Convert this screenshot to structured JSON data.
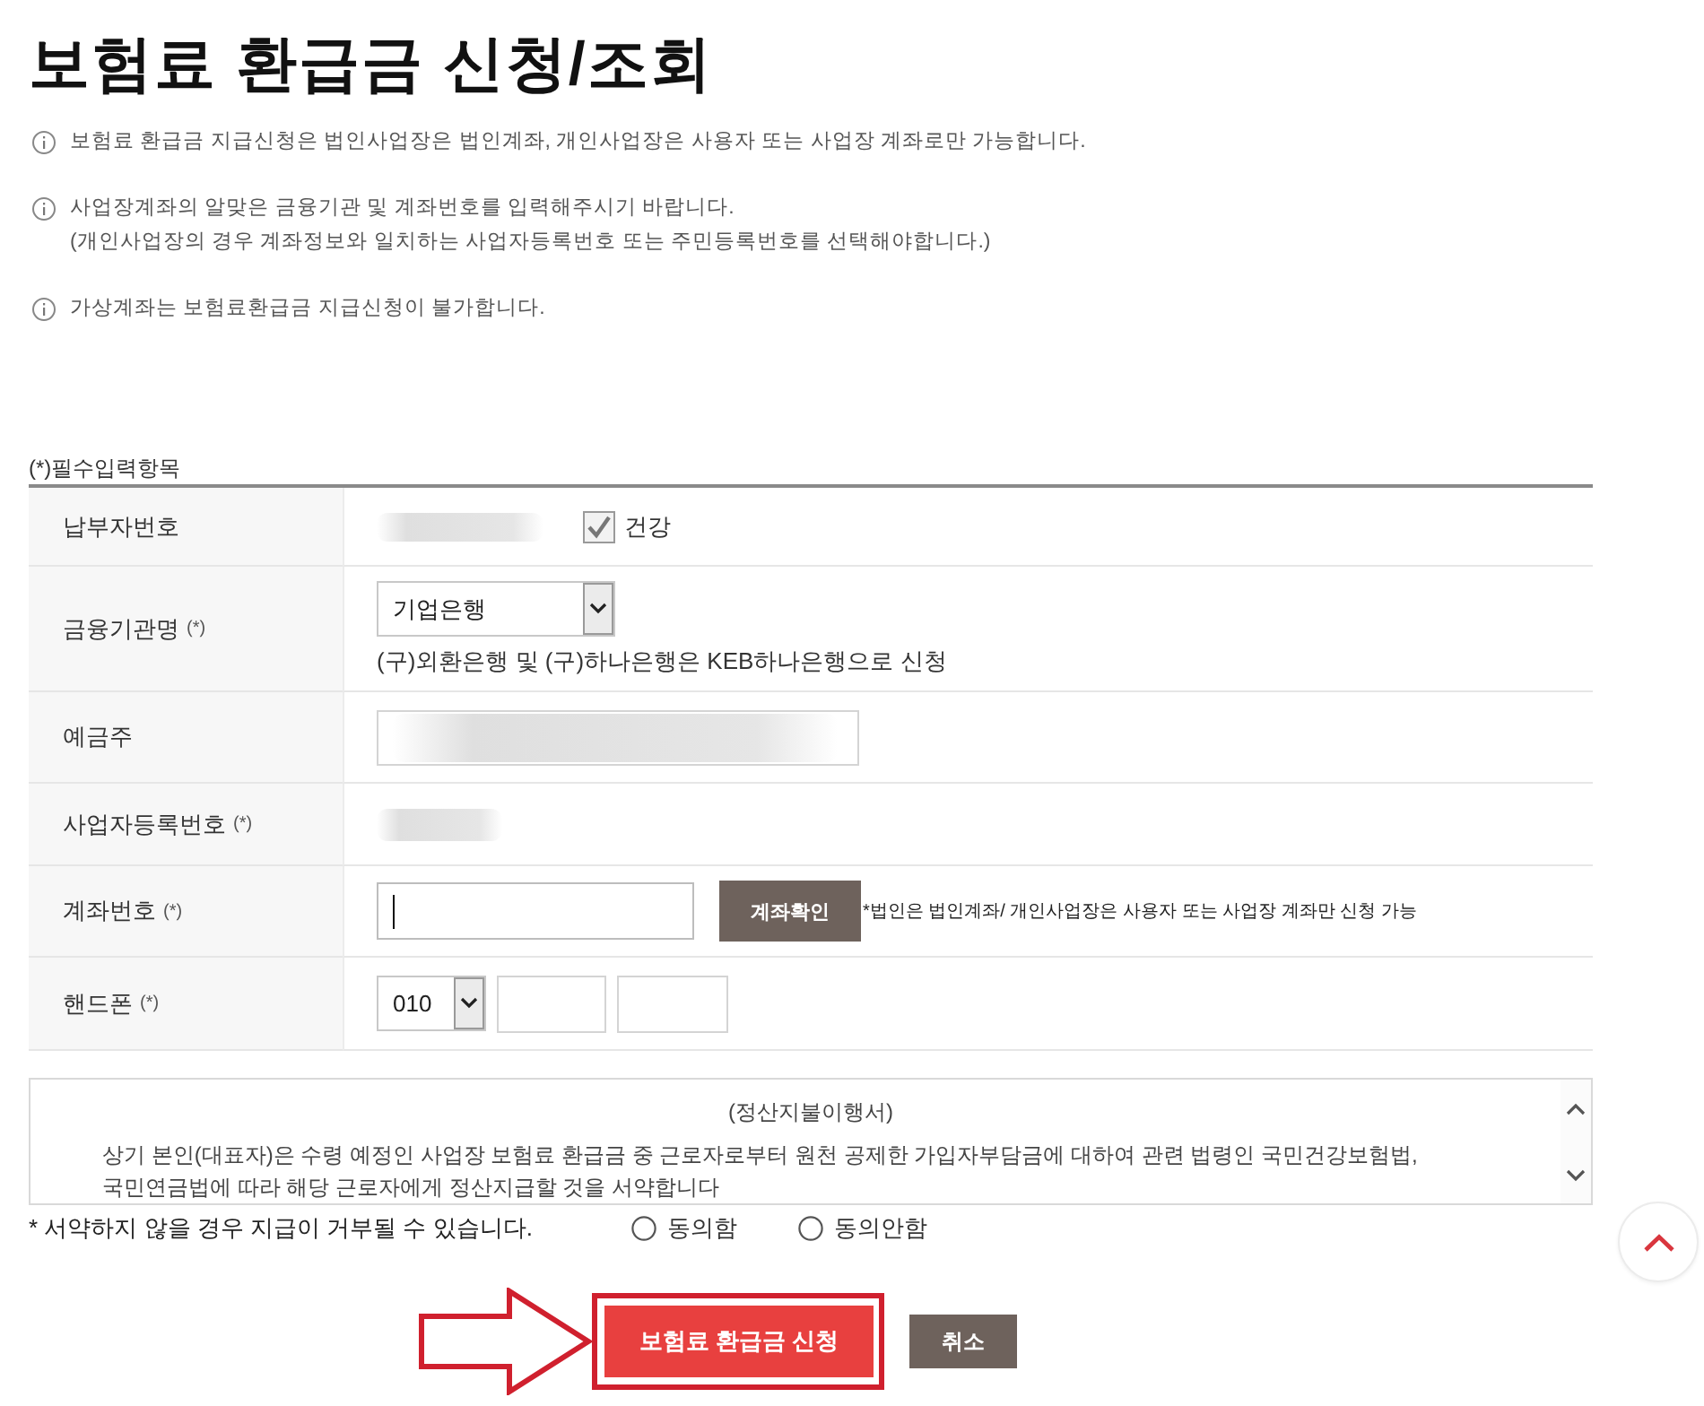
{
  "title": "보험료 환급금 신청/조회",
  "notices": [
    {
      "lines": [
        "보험료 환급금 지급신청은 법인사업장은 법인계좌, 개인사업장은 사용자 또는 사업장 계좌로만 가능합니다."
      ]
    },
    {
      "lines": [
        "사업장계좌의 알맞은 금융기관 및 계좌번호를 입력해주시기 바랍니다.",
        "(개인사업장의 경우 계좌정보와 일치하는 사업자등록번호 또는 주민등록번호를 선택해야합니다.)"
      ]
    },
    {
      "lines": [
        "가상계좌는 보험료환급금 지급신청이 불가합니다."
      ]
    }
  ],
  "required_note": "(*)필수입력항목",
  "form": {
    "rows": [
      {
        "kind": "payer",
        "label": "납부자번호",
        "checkbox": {
          "label": "건강",
          "checked": true
        }
      },
      {
        "kind": "bank",
        "label": "금융기관명",
        "required_mark": "(*)",
        "select": {
          "value": "기업은행"
        },
        "hint": "(구)외환은행 및 (구)하나은행은 KEB하나은행으로 신청"
      },
      {
        "kind": "holder",
        "label": "예금주"
      },
      {
        "kind": "business_number",
        "label": "사업자등록번호",
        "required_mark": "(*)"
      },
      {
        "kind": "account",
        "label": "계좌번호",
        "required_mark": "(*)",
        "input": {
          "focused": true
        },
        "button": "계좌확인",
        "hint": "*법인은 법인계좌/ 개인사업장은 사용자 또는 사업장 계좌만 신청 가능"
      },
      {
        "kind": "phone",
        "label": "핸드폰",
        "required_mark": "(*)",
        "select": {
          "value": "010"
        }
      }
    ]
  },
  "agreement": {
    "title": "(정산지불이행서)",
    "body": "상기 본인(대표자)은 수령 예정인 사업장 보험료 환급금 중 근로자로부터 원천 공제한 가입자부담금에 대하여 관련 법령인 국민건강보험법, 국민연금법에 따라 해당 근로자에게 정산지급할 것을 서약합니다",
    "warning": "* 서약하지 않을 경우 지급이 거부될 수 있습니다.",
    "options": [
      {
        "label": "동의함",
        "selected": false
      },
      {
        "label": "동의안함",
        "selected": false
      }
    ]
  },
  "buttons": [
    {
      "kind": "primary",
      "label": "보험료 환급금 신청",
      "highlighted": true
    },
    {
      "kind": "secondary",
      "label": "취소",
      "highlighted": false
    }
  ]
}
